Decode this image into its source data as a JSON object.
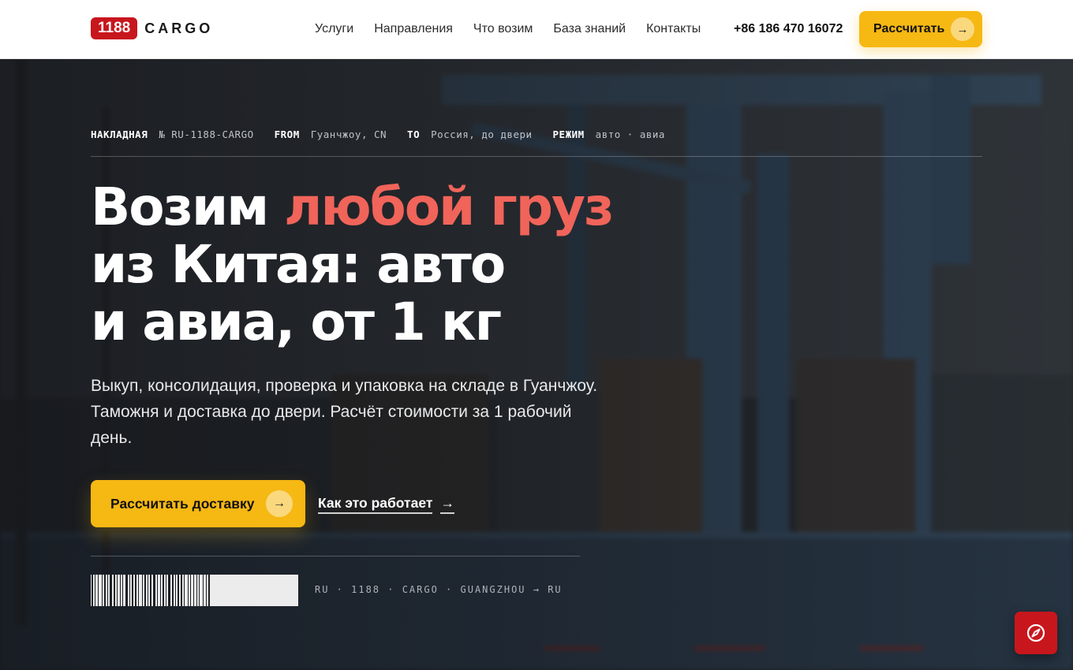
{
  "header": {
    "logo_number": "1188",
    "logo_text": "CARGO",
    "nav": [
      "Услуги",
      "Направления",
      "Что возим",
      "База знаний",
      "Контакты"
    ],
    "phone": "+86 186 470 16072",
    "calc_button": "Рассчитать",
    "arrow": "→"
  },
  "waybill": {
    "label": "НАКЛАДНАЯ",
    "number": "№ RU-1188-CARGO",
    "from_label": "FROM",
    "from_value": "Гуанчжоу, CN",
    "to_label": "TO",
    "to_value": "Россия, до двери",
    "mode_label": "РЕЖИМ",
    "mode_value": "авто · авиа"
  },
  "hero": {
    "headline_part1": "Возим ",
    "headline_accent": "любой груз",
    "headline_line2": "из Китая: авто",
    "headline_line3": "и авиа, от 1 кг",
    "lead": "Выкуп, консолидация, проверка и упаковка на складе в Гуанчжоу. Таможня и доставка до двери. Расчёт стоимости за 1 рабочий день.",
    "cta_primary": "Рассчитать доставку",
    "cta_arrow": "→",
    "cta_secondary": "Как это работает",
    "cta_secondary_arrow": "→",
    "route_code": "RU · 1188 · CARGO · GUANGZHOU → RU"
  },
  "icons": {
    "compass": "compass-icon",
    "arrow": "arrow-right-icon",
    "barcode": "barcode-icon"
  },
  "colors": {
    "brand_red": "#c8161d",
    "accent_yellow": "#f6b813",
    "headline_accent": "#f0645a"
  }
}
